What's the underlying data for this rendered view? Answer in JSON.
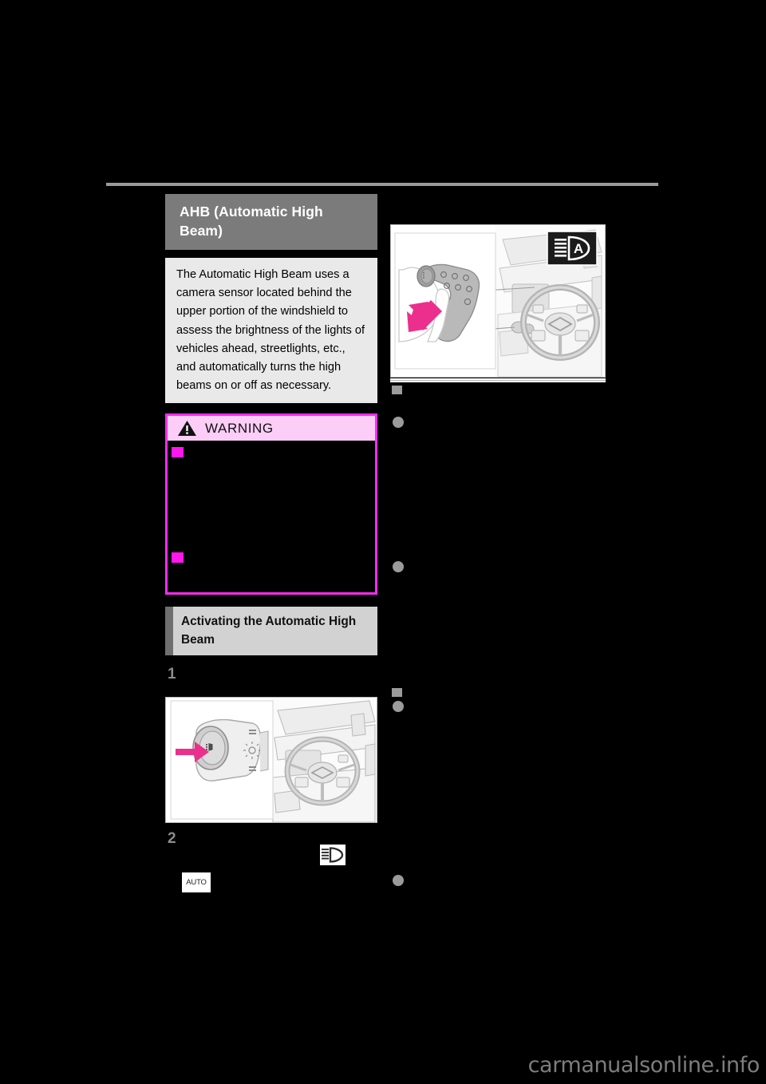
{
  "document": {
    "type": "vehicle-owners-manual-page",
    "watermark": "carmanualsonline.info"
  },
  "left_column": {
    "section_heading": "AHB (Automatic High Beam)",
    "intro_paragraph": "The Automatic High Beam uses a camera sensor located behind the upper portion of the windshield to assess the brightness of the lights of vehicles ahead, streetlights, etc., and automatically turns the high beams on or off as necessary.",
    "warning": {
      "title": "WARNING",
      "icon": "warning-triangle-icon",
      "border_color": "#ff2bf0",
      "header_bg": "#fbcdf7",
      "bullet_color": "#ff16ec",
      "bullets": [
        "",
        ""
      ]
    },
    "sub_heading": "Activating the Automatic High Beam",
    "steps": [
      {
        "number": "1",
        "text": ""
      },
      {
        "number": "2",
        "text": ""
      }
    ],
    "figure_1": {
      "name": "headlight-switch-illustration",
      "arrow_color": "#ec2f8c",
      "elements": [
        "headlight-control-dial",
        "lexus-steering-wheel",
        "dashboard"
      ]
    },
    "inline_icons": [
      {
        "name": "high-beam-indicator-icon",
        "label": ""
      },
      {
        "name": "auto-headlight-icon",
        "label": "AUTO"
      }
    ]
  },
  "right_column": {
    "figure_2": {
      "name": "turn-signal-lever-illustration",
      "arrow_color": "#ec2f8c",
      "badge": {
        "name": "ahb-indicator-badge",
        "label": "A"
      },
      "elements": [
        "turn-signal-lever",
        "hand",
        "lexus-steering-wheel",
        "dashboard"
      ]
    },
    "heading": "",
    "bullets": [
      "",
      "",
      "",
      ""
    ]
  },
  "colors": {
    "page_background": "#000000",
    "section_head_bg": "#7b7b7b",
    "sub_head_bg": "#d2d2d2",
    "intro_bg": "#e9e9e9",
    "bullet_gray": "#9b9b9b",
    "rule_gray": "#9a9a9a"
  }
}
